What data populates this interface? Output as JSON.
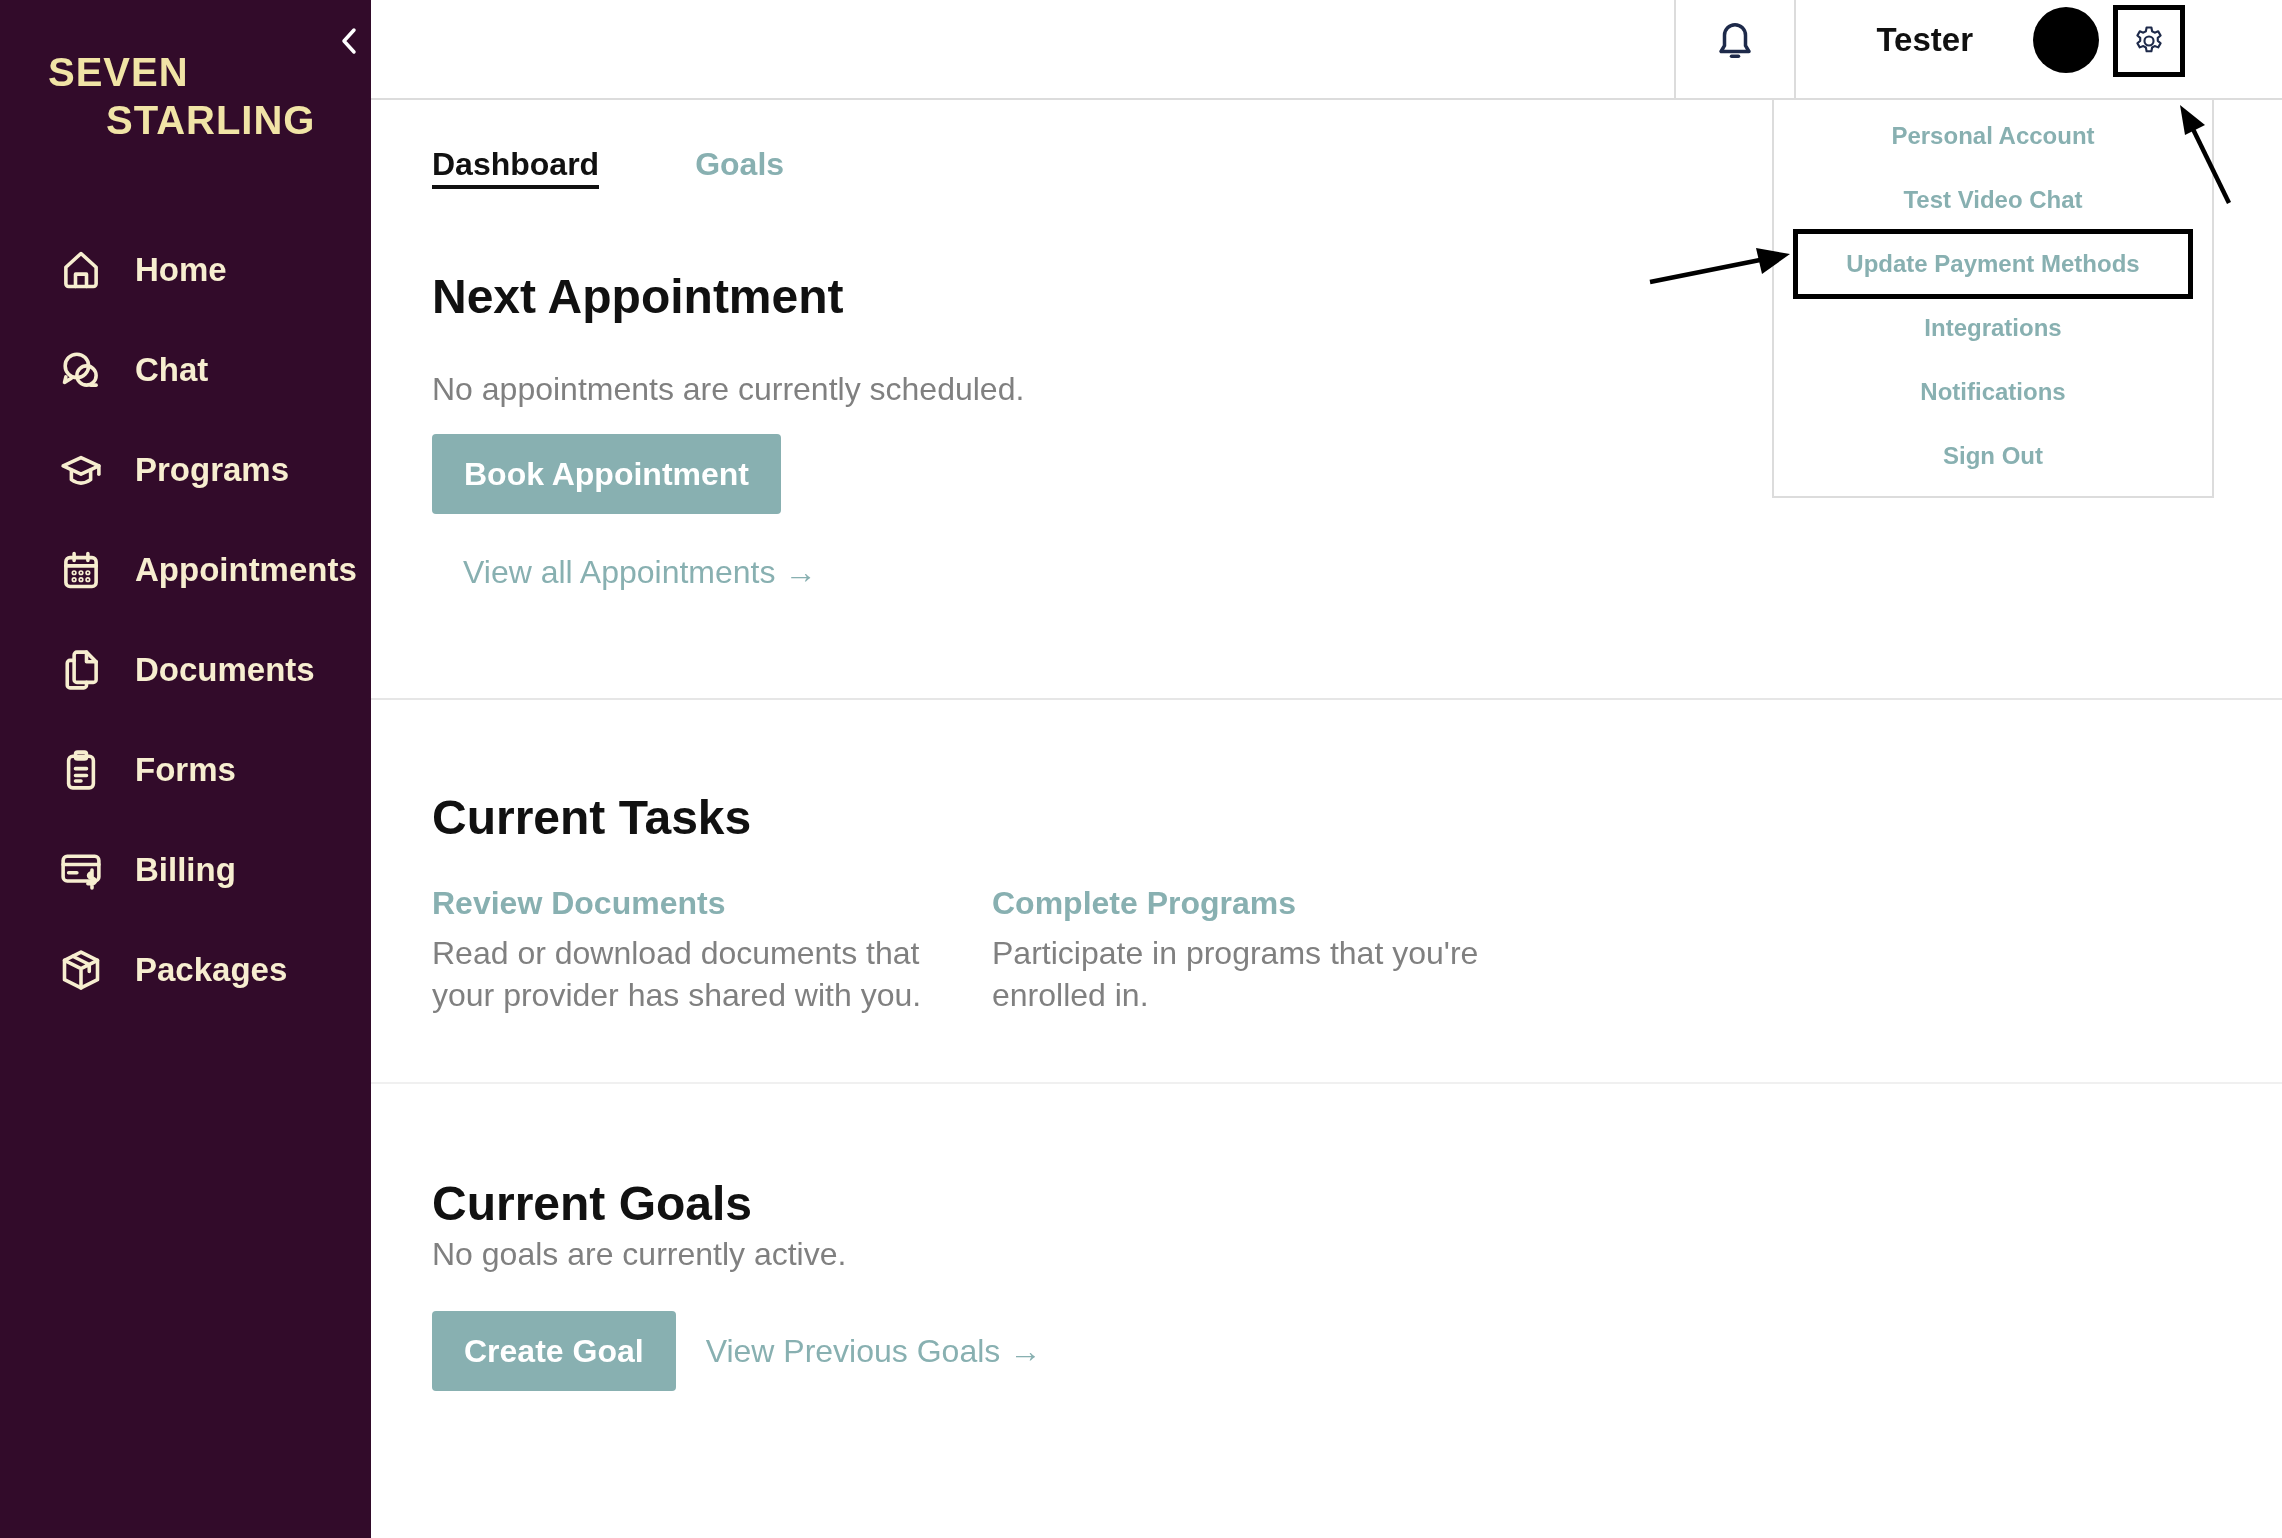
{
  "sidebar": {
    "logo": [
      "SEVEN",
      "STARLING"
    ],
    "items": [
      {
        "label": "Home",
        "kind": "home"
      },
      {
        "label": "Chat",
        "kind": "chat"
      },
      {
        "label": "Programs",
        "kind": "programs"
      },
      {
        "label": "Appointments",
        "kind": "calendar"
      },
      {
        "label": "Documents",
        "kind": "documents"
      },
      {
        "label": "Forms",
        "kind": "forms"
      },
      {
        "label": "Billing",
        "kind": "billing"
      },
      {
        "label": "Packages",
        "kind": "package"
      }
    ]
  },
  "header": {
    "user_name": "Tester",
    "settings_highlighted": true
  },
  "settings_menu": {
    "items": [
      {
        "label": "Personal Account",
        "highlighted": false
      },
      {
        "label": "Test Video Chat",
        "highlighted": false
      },
      {
        "label": "Update Payment Methods",
        "highlighted": true
      },
      {
        "label": "Integrations",
        "highlighted": false
      },
      {
        "label": "Notifications",
        "highlighted": false
      },
      {
        "label": "Sign Out",
        "highlighted": false
      }
    ]
  },
  "tabs": [
    {
      "label": "Dashboard",
      "selected": true
    },
    {
      "label": "Goals",
      "selected": false
    }
  ],
  "next_appointment": {
    "title": "Next Appointment",
    "message": "No appointments are currently scheduled.",
    "button": "Book Appointment",
    "link": "View all Appointments →"
  },
  "current_tasks": {
    "title": "Current Tasks",
    "tasks": [
      {
        "title": "Review Documents",
        "description": "Read or download documents that your provider has shared with you."
      },
      {
        "title": "Complete Programs",
        "description": "Participate in programs that you're enrolled in."
      }
    ]
  },
  "current_goals": {
    "title": "Current Goals",
    "message": "No goals are currently active.",
    "button": "Create Goal",
    "link": "View Previous Goals →"
  }
}
